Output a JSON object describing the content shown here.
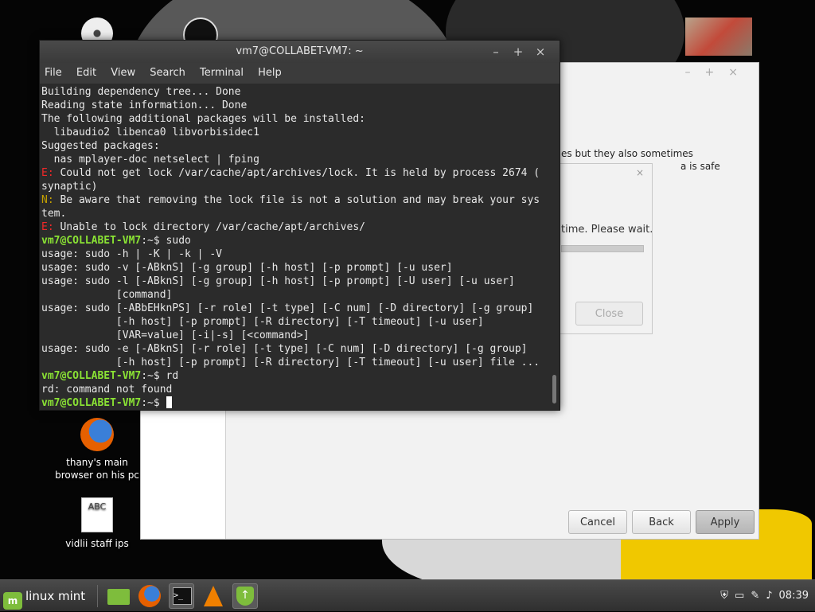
{
  "desktop": {
    "icons": [
      {
        "label": ""
      },
      {
        "label": ""
      },
      {
        "label": ""
      },
      {
        "label": "thany's main browser on his pc"
      },
      {
        "label": "vidlii staff ips",
        "doc_text": "ABC"
      }
    ]
  },
  "background_window": {
    "text_line1": "es but they also sometimes",
    "text_line2": "a is safe",
    "buttons": {
      "cancel": "Cancel",
      "back": "Back",
      "apply": "Apply"
    }
  },
  "dialog": {
    "wait_text": "time. Please wait.",
    "close_label": "Close"
  },
  "terminal": {
    "title": "vm7@COLLABET-VM7: ~",
    "controls": {
      "minimize": "–",
      "maximize": "+",
      "close": "×"
    },
    "menu": [
      "File",
      "Edit",
      "View",
      "Search",
      "Terminal",
      "Help"
    ],
    "lines": [
      {
        "text": "Building dependency tree... Done"
      },
      {
        "text": "Reading state information... Done"
      },
      {
        "text": "The following additional packages will be installed:"
      },
      {
        "text": "  libaudio2 libenca0 libvorbisidec1"
      },
      {
        "text": "Suggested packages:"
      },
      {
        "text": "  nas mplayer-doc netselect | fping"
      },
      {
        "tag": "E:",
        "text": " Could not get lock /var/cache/apt/archives/lock. It is held by process 2674 ("
      },
      {
        "text": "synaptic)"
      },
      {
        "tag": "N:",
        "text": " Be aware that removing the lock file is not a solution and may break your sys"
      },
      {
        "text": "tem."
      },
      {
        "tag": "E:",
        "text": " Unable to lock directory /var/cache/apt/archives/"
      },
      {
        "prompt": "vm7@COLLABET-VM7",
        "path": ":~$ ",
        "text": "sudo"
      },
      {
        "text": "usage: sudo -h | -K | -k | -V"
      },
      {
        "text": "usage: sudo -v [-ABknS] [-g group] [-h host] [-p prompt] [-u user]"
      },
      {
        "text": "usage: sudo -l [-ABknS] [-g group] [-h host] [-p prompt] [-U user] [-u user]"
      },
      {
        "text": "            [command]"
      },
      {
        "text": "usage: sudo [-ABbEHknPS] [-r role] [-t type] [-C num] [-D directory] [-g group]"
      },
      {
        "text": "            [-h host] [-p prompt] [-R directory] [-T timeout] [-u user]"
      },
      {
        "text": "            [VAR=value] [-i|-s] [<command>]"
      },
      {
        "text": "usage: sudo -e [-ABknS] [-r role] [-t type] [-C num] [-D directory] [-g group]"
      },
      {
        "text": "            [-h host] [-p prompt] [-R directory] [-T timeout] [-u user] file ..."
      },
      {
        "prompt": "vm7@COLLABET-VM7",
        "path": ":~$ ",
        "text": "rd"
      },
      {
        "text": "rd: command not found"
      },
      {
        "prompt": "vm7@COLLABET-VM7",
        "path": ":~$ ",
        "text": ""
      }
    ]
  },
  "taskbar": {
    "menu_label": "linux mint",
    "mint_glyph": "m",
    "clock": "08:39"
  }
}
